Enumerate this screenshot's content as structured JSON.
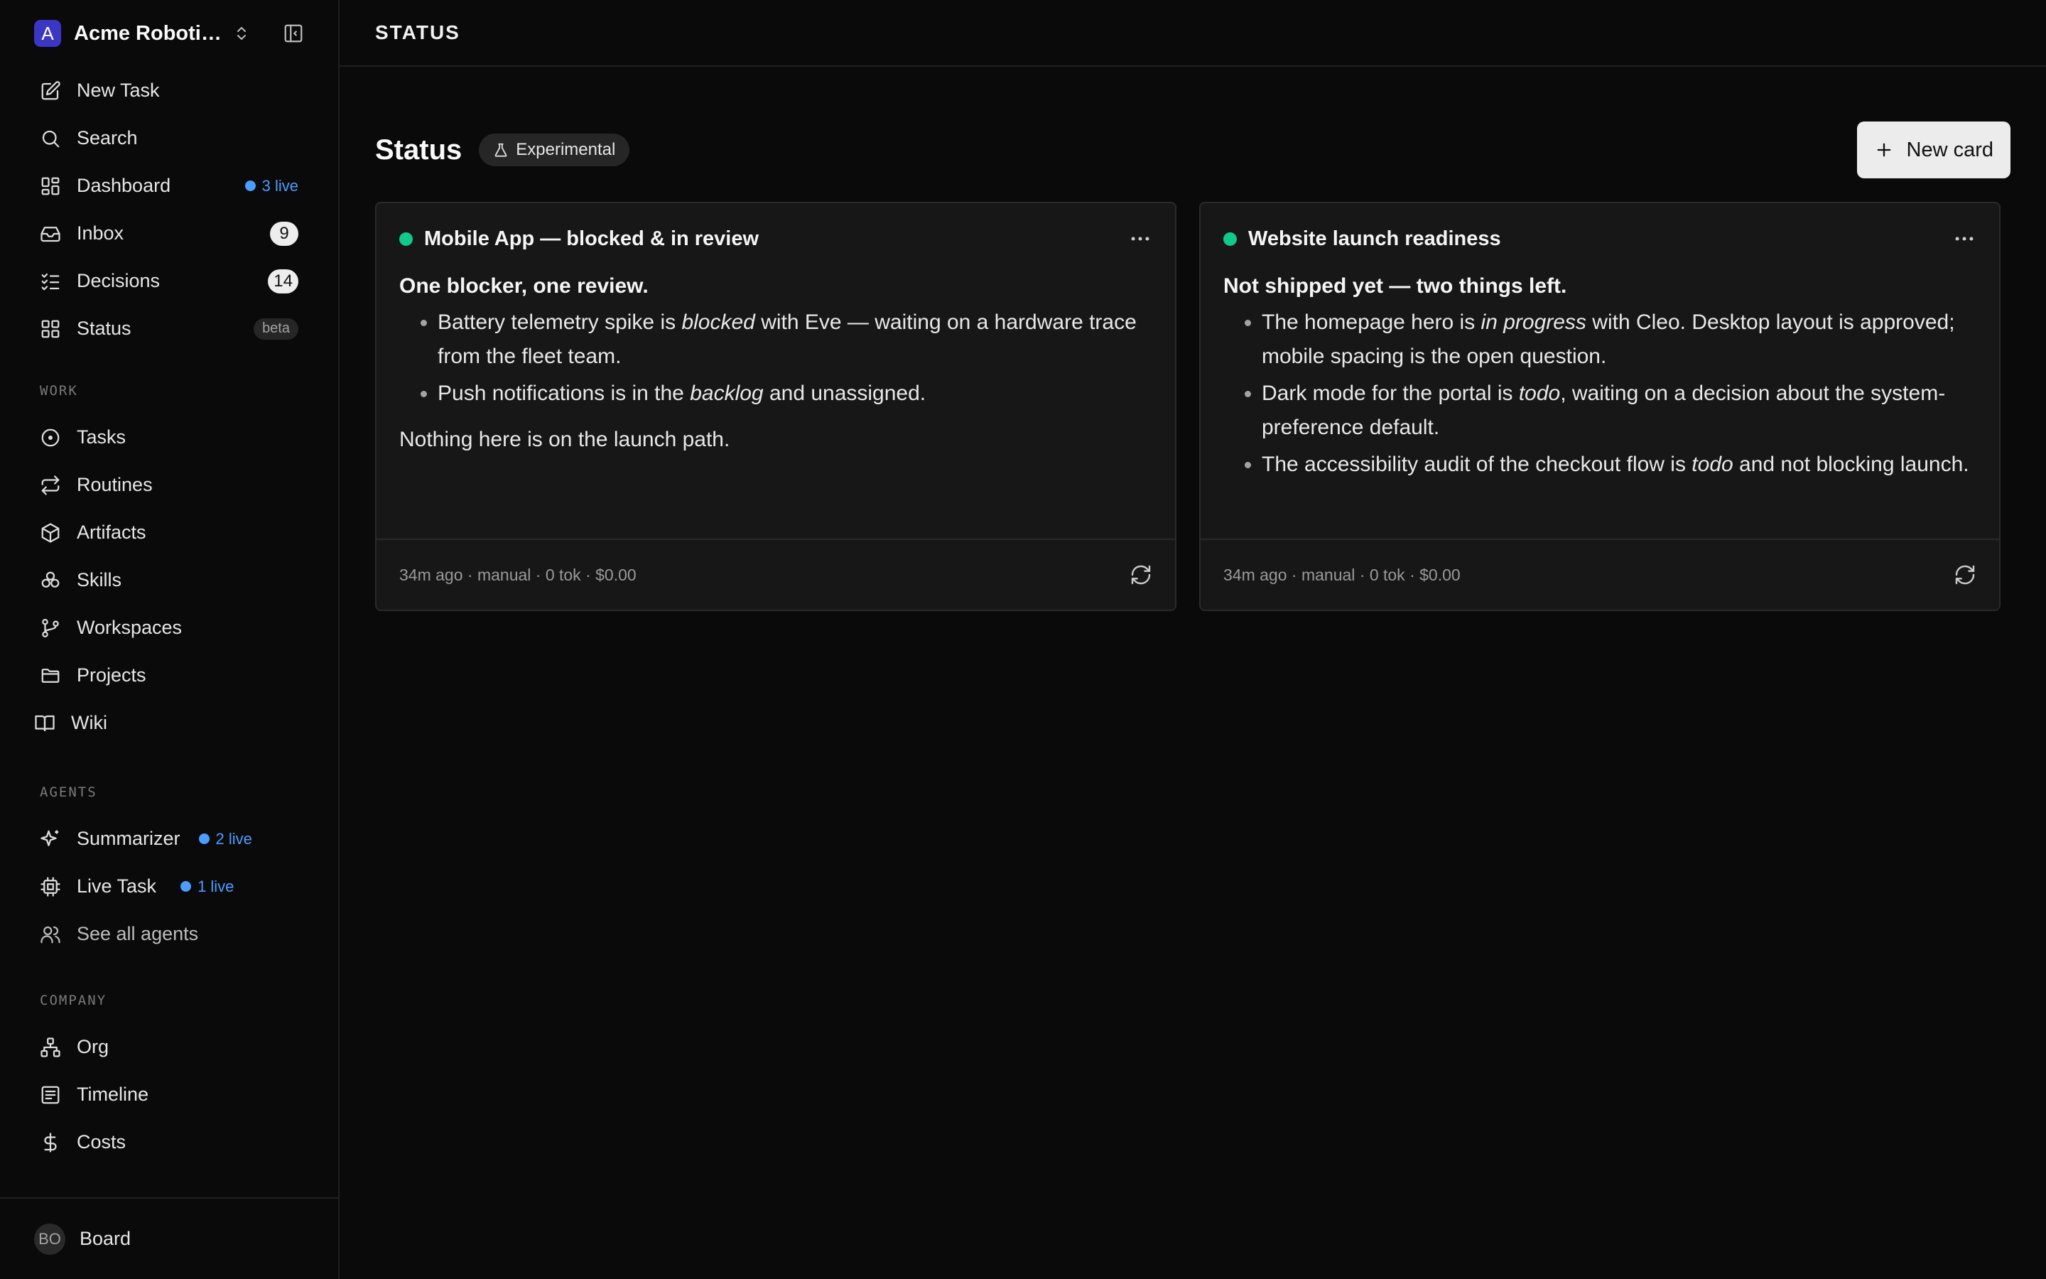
{
  "workspace": {
    "logo_letter": "A",
    "name": "Acme Roboti…"
  },
  "sidebar": {
    "primary": [
      {
        "label": "New Task",
        "icon": "edit-icon"
      },
      {
        "label": "Search",
        "icon": "search-icon"
      },
      {
        "label": "Dashboard",
        "icon": "dashboard-icon",
        "live": "3 live"
      },
      {
        "label": "Inbox",
        "icon": "inbox-icon",
        "count": "9"
      },
      {
        "label": "Decisions",
        "icon": "checklist-icon",
        "count": "14"
      },
      {
        "label": "Status",
        "icon": "grid-icon",
        "badge": "beta"
      }
    ],
    "work_label": "WORK",
    "work": [
      {
        "label": "Tasks",
        "icon": "circle-dot-icon"
      },
      {
        "label": "Routines",
        "icon": "repeat-icon"
      },
      {
        "label": "Artifacts",
        "icon": "box-icon"
      },
      {
        "label": "Skills",
        "icon": "skills-icon"
      },
      {
        "label": "Workspaces",
        "icon": "git-branch-icon"
      },
      {
        "label": "Projects",
        "icon": "folder-icon"
      },
      {
        "label": "Wiki",
        "icon": "book-icon"
      }
    ],
    "agents_label": "AGENTS",
    "agents": [
      {
        "label": "Summarizer",
        "icon": "sparkle-icon",
        "live": "2 live"
      },
      {
        "label": "Live Task",
        "icon": "cpu-icon",
        "live": "1 live"
      },
      {
        "label": "See all agents",
        "icon": "users-icon"
      }
    ],
    "company_label": "COMPANY",
    "company": [
      {
        "label": "Org",
        "icon": "org-icon"
      },
      {
        "label": "Timeline",
        "icon": "timeline-icon"
      },
      {
        "label": "Costs",
        "icon": "dollar-icon"
      }
    ],
    "footer": {
      "avatar": "BO",
      "label": "Board"
    }
  },
  "topbar": {
    "title": "STATUS"
  },
  "page": {
    "title": "Status",
    "pill": "Experimental",
    "new_card_label": "New card"
  },
  "cards": [
    {
      "title": "Mobile App — blocked & in review",
      "lead": "One blocker, one review.",
      "bullets": [
        [
          "Battery telemetry spike is ",
          "blocked",
          " with Eve — waiting on a hardware trace from the fleet team."
        ],
        [
          "Push notifications is in the ",
          "backlog",
          " and unassigned."
        ]
      ],
      "note": "Nothing here is on the launch path.",
      "meta": "34m ago · manual · 0 tok · $0.00",
      "status_color": "#10c98a"
    },
    {
      "title": "Website launch readiness",
      "lead": "Not shipped yet — two things left.",
      "bullets": [
        [
          "The homepage hero is ",
          "in progress",
          " with Cleo. Desktop layout is approved; mobile spacing is the open question."
        ],
        [
          "Dark mode for the portal is ",
          "todo",
          ", waiting on a decision about the system-preference default."
        ],
        [
          "The accessibility audit of the checkout flow is ",
          "todo",
          " and not blocking launch."
        ]
      ],
      "note": "",
      "meta": "34m ago · manual · 0 tok · $0.00",
      "status_color": "#10c98a"
    }
  ],
  "colors": {
    "accent_live": "#4c9dff",
    "status_green": "#10c98a",
    "background": "#0a0a0a"
  }
}
